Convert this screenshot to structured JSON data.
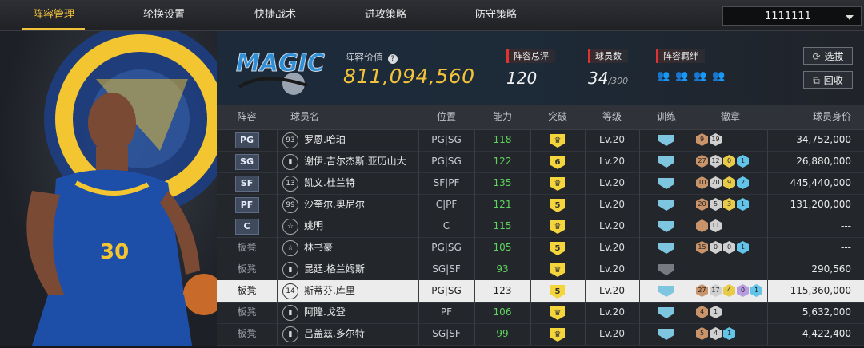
{
  "tabs": [
    "阵容管理",
    "轮换设置",
    "快捷战术",
    "进攻策略",
    "防守策略"
  ],
  "dropdown": {
    "value": "1111111"
  },
  "team": {
    "value_label": "阵容价值",
    "value_help_icon": "help-circle-icon",
    "value": "811,094,560",
    "overall_label": "阵容总评",
    "overall": "120",
    "players_label": "球员数",
    "players_count": "34",
    "players_max": "/300",
    "bond_label": "阵容羁绊",
    "bond_icons": [
      "teammates-icon",
      "teammates-icon",
      "teammates-icon",
      "teammates-icon"
    ]
  },
  "buttons": {
    "scout": "选拔",
    "recycle": "回收"
  },
  "table": {
    "headers": [
      "阵容",
      "球员名",
      "位置",
      "能力",
      "突破",
      "等级",
      "训练",
      "徽章",
      "球员身价"
    ],
    "rows": [
      {
        "slot": "PG",
        "bench": false,
        "num": "93",
        "name": "罗恩.哈珀",
        "pos": "PG|SG",
        "ovr": "118",
        "brk": "",
        "lvl": "Lv.20",
        "train": "blue",
        "badges": [
          [
            "br",
            "9"
          ],
          [
            "sv",
            "19"
          ]
        ],
        "worth": "34,752,000"
      },
      {
        "slot": "SG",
        "bench": false,
        "num": "",
        "name": "谢伊.吉尔杰斯.亚历山大",
        "pos": "PG|SG",
        "ovr": "122",
        "brk": "6",
        "lvl": "Lv.20",
        "train": "blue",
        "badges": [
          [
            "br",
            "27"
          ],
          [
            "sv",
            "12"
          ],
          [
            "gd",
            "0"
          ],
          [
            "bl",
            "1"
          ]
        ],
        "worth": "26,880,000"
      },
      {
        "slot": "SF",
        "bench": false,
        "num": "13",
        "name": "凯文.杜兰特",
        "pos": "SF|PF",
        "ovr": "135",
        "brk": "",
        "lvl": "Lv.20",
        "train": "blue",
        "badges": [
          [
            "br",
            "10"
          ],
          [
            "sv",
            "20"
          ],
          [
            "gd",
            "9"
          ],
          [
            "bl",
            "2"
          ]
        ],
        "worth": "445,440,000"
      },
      {
        "slot": "PF",
        "bench": false,
        "num": "99",
        "name": "沙奎尔.奥尼尔",
        "pos": "C|PF",
        "ovr": "121",
        "brk": "5",
        "lvl": "Lv.20",
        "train": "blue",
        "badges": [
          [
            "br",
            "20"
          ],
          [
            "sv",
            "5"
          ],
          [
            "gd",
            "3"
          ],
          [
            "bl",
            "1"
          ]
        ],
        "worth": "131,200,000"
      },
      {
        "slot": "C",
        "bench": false,
        "num": "☆",
        "name": "姚明",
        "pos": "C",
        "ovr": "115",
        "brk": "",
        "lvl": "Lv.20",
        "train": "blue",
        "badges": [
          [
            "br",
            "1"
          ],
          [
            "sv",
            "11"
          ]
        ],
        "worth": "---"
      },
      {
        "slot": "板凳",
        "bench": true,
        "num": "☆",
        "name": "林书豪",
        "pos": "PG|SG",
        "ovr": "105",
        "brk": "5",
        "lvl": "Lv.20",
        "train": "blue",
        "badges": [
          [
            "br",
            "15"
          ],
          [
            "sv",
            "0"
          ],
          [
            "sv",
            "0"
          ],
          [
            "bl",
            "1"
          ]
        ],
        "worth": "---"
      },
      {
        "slot": "板凳",
        "bench": true,
        "num": "",
        "name": "昆廷.格兰姆斯",
        "pos": "SG|SF",
        "ovr": "93",
        "brk": "",
        "lvl": "Lv.20",
        "train": "grey",
        "badges": [],
        "worth": "290,560"
      },
      {
        "slot": "板凳",
        "bench": true,
        "num": "14",
        "name": "斯蒂芬.库里",
        "pos": "PG|SG",
        "ovr": "123",
        "brk": "5",
        "lvl": "Lv.20",
        "train": "blue",
        "badges": [
          [
            "br",
            "27"
          ],
          [
            "sv",
            "17"
          ],
          [
            "gd",
            "4"
          ],
          [
            "hf",
            "0"
          ],
          [
            "bl",
            "1"
          ]
        ],
        "worth": "115,360,000",
        "selected": true
      },
      {
        "slot": "板凳",
        "bench": true,
        "num": "",
        "name": "阿隆.戈登",
        "pos": "PF",
        "ovr": "106",
        "brk": "",
        "lvl": "Lv.20",
        "train": "blue",
        "badges": [
          [
            "br",
            "4"
          ],
          [
            "sv",
            "1"
          ]
        ],
        "worth": "5,632,000"
      },
      {
        "slot": "板凳",
        "bench": true,
        "num": "",
        "name": "吕盖兹.多尔特",
        "pos": "SG|SF",
        "ovr": "99",
        "brk": "",
        "lvl": "Lv.20",
        "train": "blue",
        "badges": [
          [
            "br",
            "5"
          ],
          [
            "sv",
            "4"
          ],
          [
            "bl",
            "1"
          ]
        ],
        "worth": "4,422,400"
      }
    ]
  },
  "colors": {
    "accent": "#f2c23b",
    "ability": "#5fd35f",
    "selected_row": "#ececec"
  }
}
